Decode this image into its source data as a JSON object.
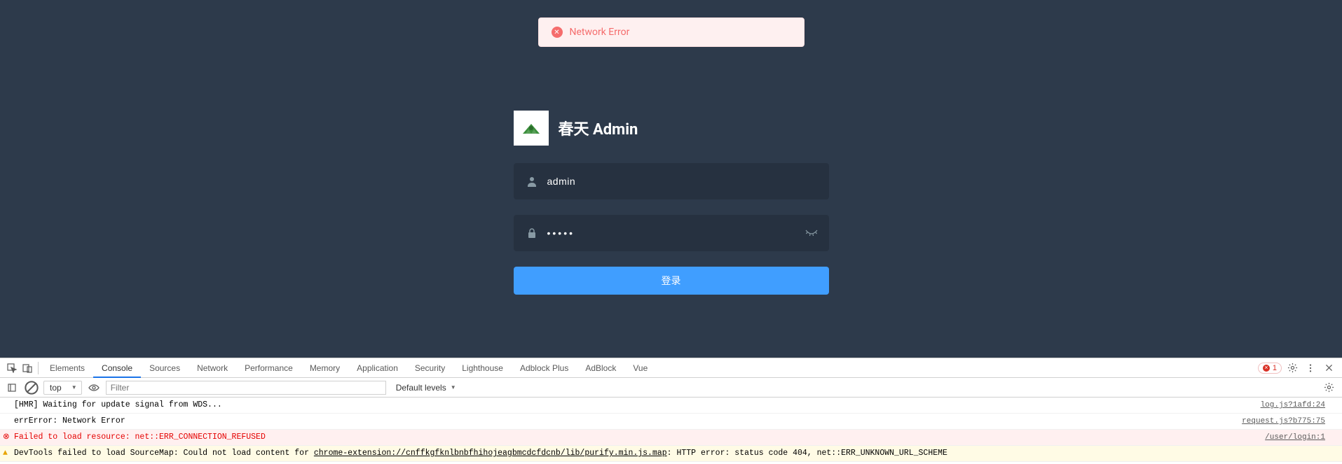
{
  "toast": {
    "message": "Network Error"
  },
  "login": {
    "title": "春天 Admin",
    "username_value": "admin",
    "password_value": "•••••",
    "submit_label": "登录"
  },
  "devtools": {
    "tabs": [
      "Elements",
      "Console",
      "Sources",
      "Network",
      "Performance",
      "Memory",
      "Application",
      "Security",
      "Lighthouse",
      "Adblock Plus",
      "AdBlock",
      "Vue"
    ],
    "active_tab": "Console",
    "error_count": "1",
    "context_select": "top",
    "filter_placeholder": "Filter",
    "level_label": "Default levels",
    "log": [
      {
        "type": "log",
        "msg": "[HMR] Waiting for update signal from WDS...",
        "src": "log.js?1afd:24"
      },
      {
        "type": "log",
        "msg": "errError: Network Error",
        "src": "request.js?b775:75"
      },
      {
        "type": "err",
        "msg": "Failed to load resource: net::ERR_CONNECTION_REFUSED",
        "src": "/user/login:1"
      },
      {
        "type": "warn",
        "msg_pre": "DevTools failed to load SourceMap: Could not load content for ",
        "msg_link": "chrome-extension://cnffkgfknlbnbfhihojeagbmcdcfdcnb/lib/purify.min.js.map",
        "msg_post": ": HTTP error: status code 404, net::ERR_UNKNOWN_URL_SCHEME",
        "src": ""
      }
    ]
  }
}
